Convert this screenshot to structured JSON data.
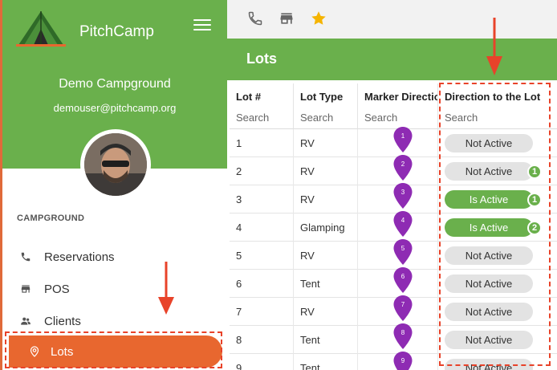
{
  "sidebar": {
    "app_title": "PitchCamp",
    "campground_name": "Demo Campground",
    "user_email": "demouser@pitchcamp.org",
    "section_title": "CAMPGROUND",
    "items": [
      {
        "label": "Reservations",
        "icon": "phone-icon"
      },
      {
        "label": "POS",
        "icon": "store-icon"
      },
      {
        "label": "Clients",
        "icon": "people-icon"
      },
      {
        "label": "Lots",
        "icon": "location-pin-icon",
        "active": true
      }
    ]
  },
  "toolbar": {
    "icons": [
      "phone-icon",
      "store-icon",
      "star-icon"
    ],
    "star_color": "#f5b400"
  },
  "page": {
    "title": "Lots"
  },
  "table": {
    "columns": [
      {
        "label": "Lot #",
        "search": "Search"
      },
      {
        "label": "Lot Type",
        "search": "Search"
      },
      {
        "label": "Marker Direction",
        "search": "Search"
      },
      {
        "label": "Direction to the Lot",
        "search": "Search"
      }
    ],
    "rows": [
      {
        "lot": "1",
        "type": "RV",
        "marker": "1",
        "status": "Not Active",
        "active": false,
        "badge": ""
      },
      {
        "lot": "2",
        "type": "RV",
        "marker": "2",
        "status": "Not Active",
        "active": false,
        "badge": "1"
      },
      {
        "lot": "3",
        "type": "RV",
        "marker": "3",
        "status": "Is Active",
        "active": true,
        "badge": "1"
      },
      {
        "lot": "4",
        "type": "Glamping",
        "marker": "4",
        "status": "Is Active",
        "active": true,
        "badge": "2"
      },
      {
        "lot": "5",
        "type": "RV",
        "marker": "5",
        "status": "Not Active",
        "active": false,
        "badge": ""
      },
      {
        "lot": "6",
        "type": "Tent",
        "marker": "6",
        "status": "Not Active",
        "active": false,
        "badge": ""
      },
      {
        "lot": "7",
        "type": "RV",
        "marker": "7",
        "status": "Not Active",
        "active": false,
        "badge": ""
      },
      {
        "lot": "8",
        "type": "Tent",
        "marker": "8",
        "status": "Not Active",
        "active": false,
        "badge": ""
      },
      {
        "lot": "9",
        "type": "Tent",
        "marker": "9",
        "status": "Not Active",
        "active": false,
        "badge": ""
      }
    ]
  },
  "colors": {
    "brand_green": "#6ab04c",
    "active_orange": "#e8672f",
    "marker_purple": "#8e2bb3",
    "annotation_red": "#e8432a"
  }
}
